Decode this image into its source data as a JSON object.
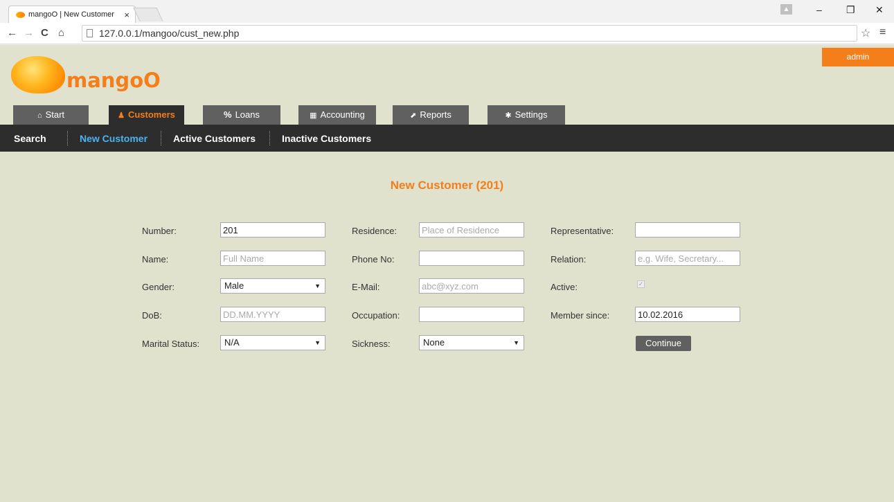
{
  "browser": {
    "tab_title": "mangoO | New Customer",
    "tab_close": "×",
    "url": "127.0.0.1/mangoo/cust_new.php",
    "profile_icon": "person-icon",
    "back_icon": "←",
    "forward_icon": "→",
    "reload_icon": "C",
    "home_icon": "⌂",
    "minimize": "–",
    "restore": "❐",
    "close": "✕",
    "star": "☆",
    "menu": "≡"
  },
  "header": {
    "brand": "mangoO",
    "user_button": "admin"
  },
  "nav": {
    "tabs": [
      {
        "label": "Start",
        "icon": "home-icon",
        "glyph": "⌂"
      },
      {
        "label": "Customers",
        "icon": "user-icon",
        "glyph": "♟",
        "active": true
      },
      {
        "label": "Loans",
        "icon": "percent-icon",
        "glyph": "%"
      },
      {
        "label": "Accounting",
        "icon": "calculator-icon",
        "glyph": "▦"
      },
      {
        "label": "Reports",
        "icon": "chart-line-icon",
        "glyph": "⬈"
      },
      {
        "label": "Settings",
        "icon": "gear-icon",
        "glyph": "✱"
      }
    ],
    "subnav": [
      {
        "label": "Search"
      },
      {
        "label": "New Customer",
        "active": true
      },
      {
        "label": "Active Customers"
      },
      {
        "label": "Inactive Customers"
      }
    ]
  },
  "form": {
    "title": "New Customer (201)",
    "number": {
      "label": "Number:",
      "value": "201"
    },
    "name": {
      "label": "Name:",
      "placeholder": "Full Name"
    },
    "gender": {
      "label": "Gender:",
      "selected": "Male"
    },
    "dob": {
      "label": "DoB:",
      "placeholder": "DD.MM.YYYY"
    },
    "marital": {
      "label": "Marital Status:",
      "selected": "N/A"
    },
    "residence": {
      "label": "Residence:",
      "placeholder": "Place of Residence"
    },
    "phone": {
      "label": "Phone No:",
      "value": ""
    },
    "email": {
      "label": "E-Mail:",
      "placeholder": "abc@xyz.com"
    },
    "occupation": {
      "label": "Occupation:",
      "value": ""
    },
    "sickness": {
      "label": "Sickness:",
      "selected": "None"
    },
    "representative": {
      "label": "Representative:",
      "value": ""
    },
    "relation": {
      "label": "Relation:",
      "placeholder": "e.g. Wife, Secretary..."
    },
    "active": {
      "label": "Active:",
      "checked": true
    },
    "member_since": {
      "label": "Member since:",
      "value": "10.02.2016"
    },
    "continue_label": "Continue"
  },
  "colors": {
    "accent": "#f37e1a",
    "page_bg": "#e0e2cd",
    "nav_dark": "#2d2d2d",
    "tab_grey": "#606060",
    "subnav_active": "#4cb3ef"
  }
}
